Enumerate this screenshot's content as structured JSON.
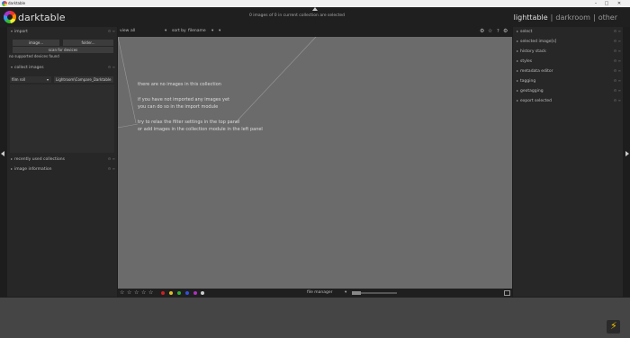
{
  "window": {
    "title": "darktable",
    "controls": [
      "–",
      "□",
      "✕"
    ]
  },
  "header": {
    "logo_text": "darktable",
    "status": "0 images of 0 in current collection are selected",
    "views": [
      "lighttable",
      "darkroom",
      "other"
    ],
    "separator": "|"
  },
  "left_panel": {
    "import": {
      "label": "import",
      "image_button": "image...",
      "folder_button": "folder...",
      "scan_button": "scan for devices",
      "devices_status": "no supported devices found"
    },
    "collect": {
      "label": "collect images",
      "filter_select": "film roll",
      "filter_value": "Lightroom\\Compare_Darktable"
    },
    "recent_label": "recently used collections",
    "image_info_label": "image information"
  },
  "filter_bar": {
    "view_label": "view",
    "view_value": "all",
    "sort_label": "sort by",
    "sort_value": "filename"
  },
  "center": {
    "line1": "there are no images in this collection",
    "line2": "if you have not imported any images yet",
    "line3": "you can do so in the import module",
    "line4": "try to relax the filter settings in the top panel",
    "line5": "or add images in the collection module in the left panel"
  },
  "right_panel": {
    "modules": [
      "select",
      "selected image[s]",
      "history stack",
      "styles",
      "metadata editor",
      "tagging",
      "geotagging",
      "export selected"
    ]
  },
  "bottom_bar": {
    "stars": [
      "☆",
      "☆",
      "☆",
      "☆",
      "☆"
    ],
    "color_labels": [
      "#d02020",
      "#e0c020",
      "#30b030",
      "#3050e0",
      "#b030c0",
      "#cccccc"
    ],
    "layout_select": "file manager"
  },
  "icons": [
    "settings-icon",
    "star-icon",
    "help-icon",
    "preferences-icon"
  ]
}
